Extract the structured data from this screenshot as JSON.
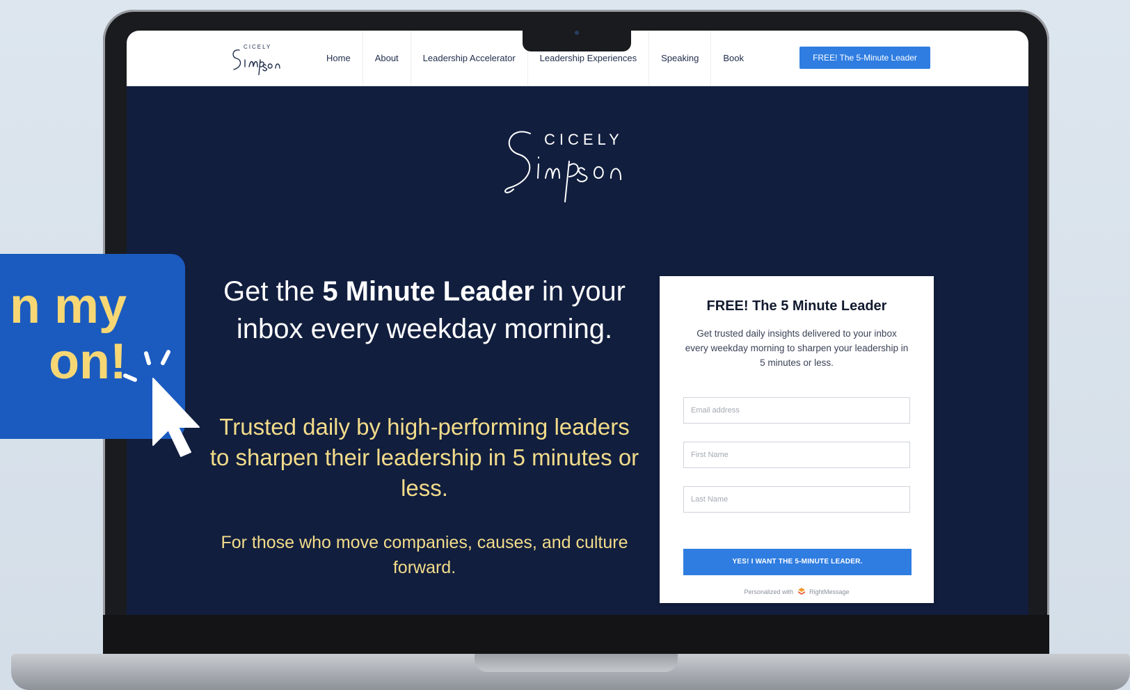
{
  "nav": {
    "logo_text": "Cicely Simpson",
    "links": [
      "Home",
      "About",
      "Leadership Accelerator",
      "Leadership Experiences",
      "Speaking",
      "Book"
    ],
    "cta": "FREE! The 5-Minute Leader"
  },
  "hero": {
    "logo_top": "CICELY",
    "logo_script": "Simpson",
    "headline_pre": "Get the ",
    "headline_bold": "5 Minute Leader",
    "headline_post": " in your inbox every weekday morning.",
    "subhead": "Trusted daily by high-performing leaders to sharpen their leadership in 5 minutes or less.",
    "tagline": "For those who move companies, causes, and culture forward."
  },
  "form": {
    "title": "FREE! The 5 Minute Leader",
    "description": "Get trusted daily insights delivered to your inbox every weekday morning to sharpen your leadership in 5 minutes or less.",
    "email_placeholder": "Email address",
    "first_name_placeholder": "First Name",
    "last_name_placeholder": "Last Name",
    "submit_label": "YES! I WANT THE 5-MINUTE LEADER.",
    "powered_prefix": "Personalized with",
    "powered_brand": "RightMessage"
  },
  "callout": {
    "text": "n my\non!"
  },
  "colors": {
    "hero_bg": "#111e3e",
    "accent_blue": "#2f7de1",
    "gold": "#f3dc8a",
    "callout_bg": "#1b5bbf",
    "callout_text": "#f7d774"
  }
}
